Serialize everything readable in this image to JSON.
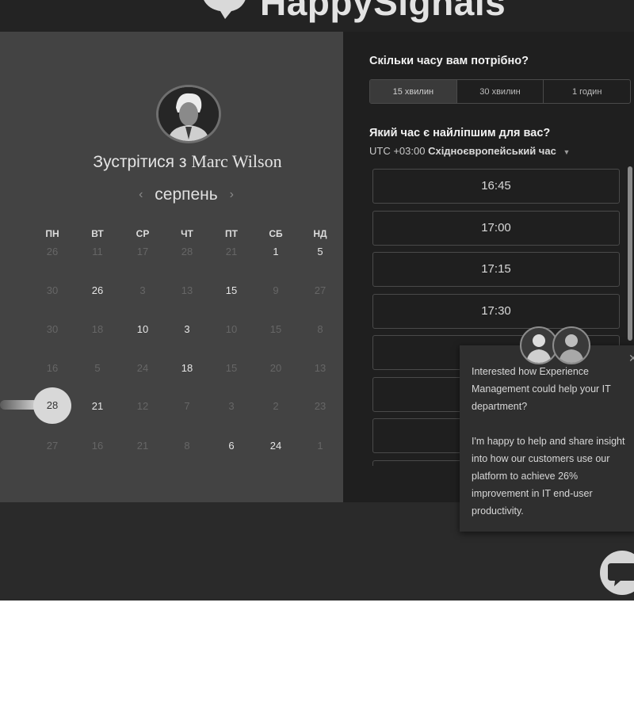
{
  "brand": {
    "name": "HappySignals"
  },
  "left": {
    "title_prefix": "Зустрітися з",
    "host_name": "Marc Wilson",
    "month": "серпень",
    "prev_arrow": "‹",
    "next_arrow": "›",
    "weekdays": [
      "ПН",
      "ВТ",
      "СР",
      "ЧТ",
      "ПТ",
      "СБ",
      "НД"
    ],
    "weeks": [
      [
        "26",
        "11",
        "17",
        "28",
        "21",
        "1",
        "5"
      ],
      [
        "30",
        "26",
        "3",
        "13",
        "15",
        "9",
        "27"
      ],
      [
        "30",
        "18",
        "10",
        "3",
        "10",
        "15",
        "8"
      ],
      [
        "16",
        "5",
        "24",
        "18",
        "15",
        "20",
        "13"
      ],
      [
        "28",
        "21",
        "12",
        "7",
        "3",
        "2",
        "23"
      ],
      [
        "27",
        "16",
        "21",
        "8",
        "6",
        "24",
        "1"
      ]
    ],
    "available_days": [
      "1",
      "5",
      "26",
      "15",
      "10",
      "3",
      "18",
      "21",
      "6",
      "24"
    ],
    "selected_day": "28"
  },
  "right": {
    "duration_question": "Скільки часу вам потрібно?",
    "durations": [
      "15 хвилин",
      "30 хвилин",
      "1 годин"
    ],
    "active_duration": "15 хвилин",
    "time_question": "Який час є найліпшим для вас?",
    "tz_offset": "UTC +03:00",
    "tz_name": "Східноєвропейський час",
    "slots": [
      "16:45",
      "17:00",
      "17:15",
      "17:30",
      "",
      "",
      "",
      ""
    ]
  },
  "popup": {
    "paragraph1": "Interested how Experience Management could help your IT department?",
    "paragraph2": "I'm happy to help and share insight into how our customers use our platform to achieve 26% improvement in IT end-user productivity.",
    "close_label": "✕"
  },
  "icons": {
    "logo": "chat-bubble-heart-logo",
    "chat": "chat-bubble-icon",
    "close": "close-icon",
    "caret": "chevron-down-icon"
  },
  "colors": {
    "page_bg": "#262626",
    "calendar_bg": "#434343",
    "times_bg": "#1f1f1f",
    "selected_day_bg": "#d8d8d8"
  }
}
